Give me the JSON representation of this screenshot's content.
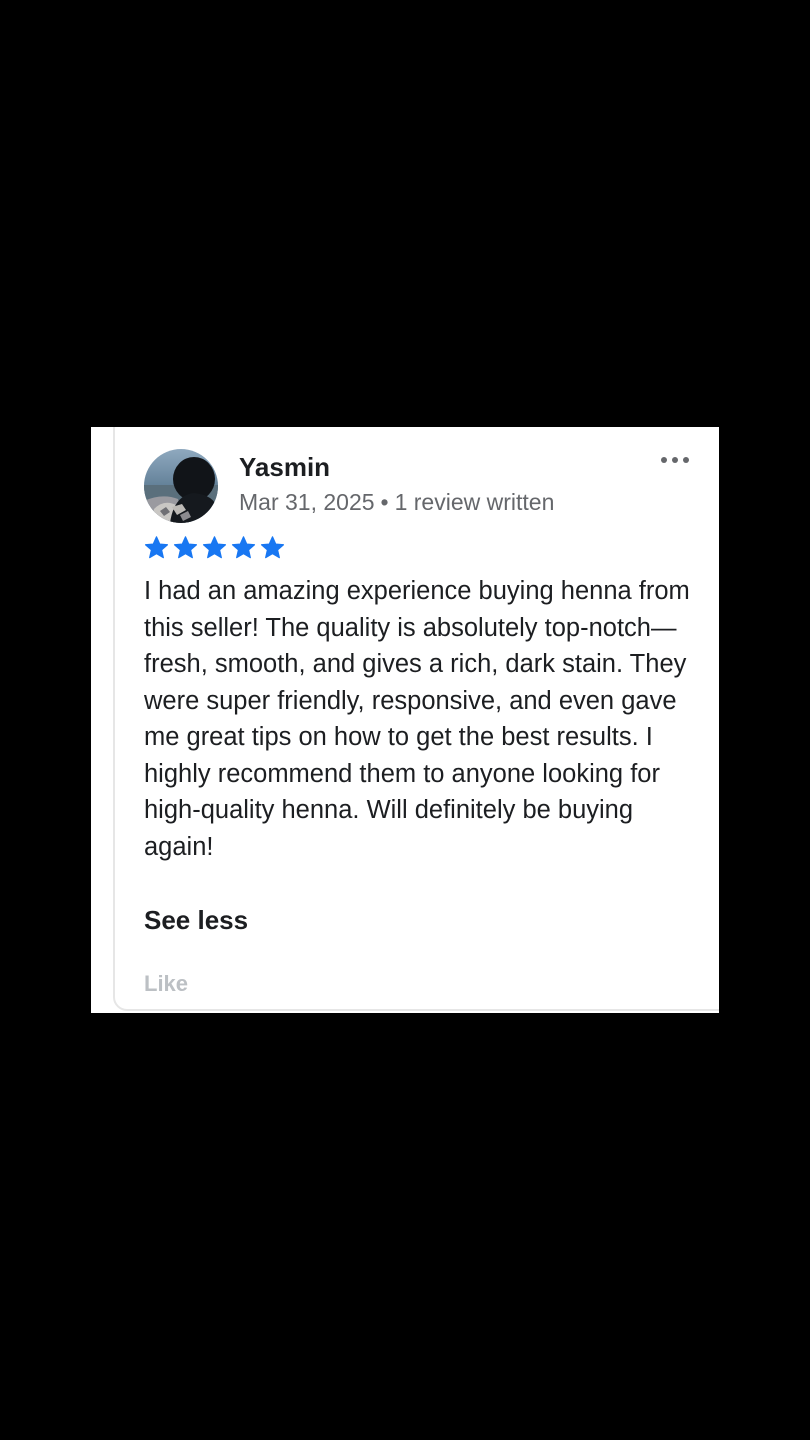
{
  "review": {
    "reviewer_name": "Yasmin",
    "date": "Mar 31, 2025",
    "separator": "•",
    "review_count_text": "1 review written",
    "rating": 5,
    "rating_max": 5,
    "star_color": "#1877f2",
    "body": "I had an amazing experience buying henna from this seller! The quality is absolutely top-notch—fresh, smooth, and gives a rich, dark stain. They were super friendly, responsive, and even gave me great tips on how to get the best results. I highly recommend them to anyone looking for high-quality henna. Will definitely be buying again!",
    "see_less_label": "See less",
    "like_label": "Like"
  },
  "icons": {
    "more": "more-options-icon",
    "star": "star-icon",
    "avatar": "avatar-photo"
  },
  "colors": {
    "background": "#000000",
    "card": "#ffffff",
    "text_primary": "#1c1e21",
    "text_secondary": "#65676b",
    "like_disabled": "#bcc0c4"
  }
}
